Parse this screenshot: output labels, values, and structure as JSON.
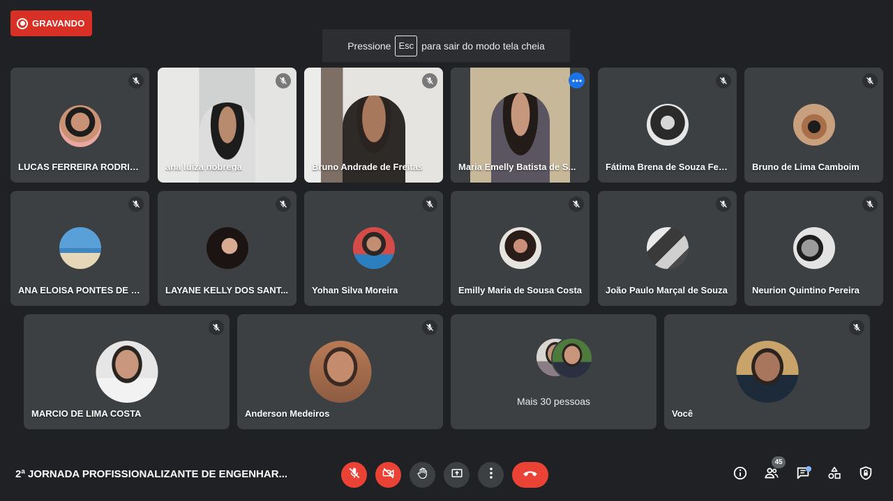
{
  "recording": {
    "label": "GRAVANDO"
  },
  "fullscreen_hint": {
    "before": "Pressione",
    "key": "Esc",
    "after": "para sair do modo tela cheia"
  },
  "participants": [
    {
      "name": "LUCAS FERREIRA RODRIG...",
      "type": "avatar"
    },
    {
      "name": "ana luiza nobrega",
      "type": "video"
    },
    {
      "name": "Bruno Andrade de Freitas",
      "type": "video"
    },
    {
      "name": "Maria Emelly Batista de S...",
      "type": "video",
      "active": true
    },
    {
      "name": "Fátima Brena de Souza Felí...",
      "type": "avatar"
    },
    {
      "name": "Bruno de Lima Camboim",
      "type": "avatar"
    },
    {
      "name": "ANA ELOISA PONTES DE S...",
      "type": "avatar"
    },
    {
      "name": "LAYANE KELLY DOS SANT...",
      "type": "avatar"
    },
    {
      "name": "Yohan Silva Moreira",
      "type": "avatar"
    },
    {
      "name": "Emilly Maria de Sousa Costa",
      "type": "avatar"
    },
    {
      "name": "João Paulo Marçal de Souza",
      "type": "avatar"
    },
    {
      "name": "Neurion Quintino Pereira",
      "type": "avatar"
    },
    {
      "name": "MARCIO DE LIMA COSTA",
      "type": "avatar"
    },
    {
      "name": "Anderson Medeiros",
      "type": "avatar"
    },
    {
      "name": "Você",
      "type": "avatar"
    }
  ],
  "more_people": {
    "label": "Mais 30 pessoas"
  },
  "meeting": {
    "title": "2ª JORNADA PROFISSIONALIZANTE DE ENGENHAR..."
  },
  "people_count": "45",
  "icons": {
    "mic": "mic-off-icon",
    "camera": "camera-off-icon",
    "hand": "hand-icon",
    "present": "present-icon",
    "more": "more-vert-icon",
    "hangup": "hangup-icon",
    "info": "info-icon",
    "people": "people-icon",
    "chat": "chat-icon",
    "activities": "activities-icon",
    "safety": "shield-icon"
  },
  "colors": {
    "record": "#d93025",
    "danger": "#ea4335",
    "accent": "#8ab4f8",
    "tile": "#3c4043",
    "background": "#202124"
  }
}
